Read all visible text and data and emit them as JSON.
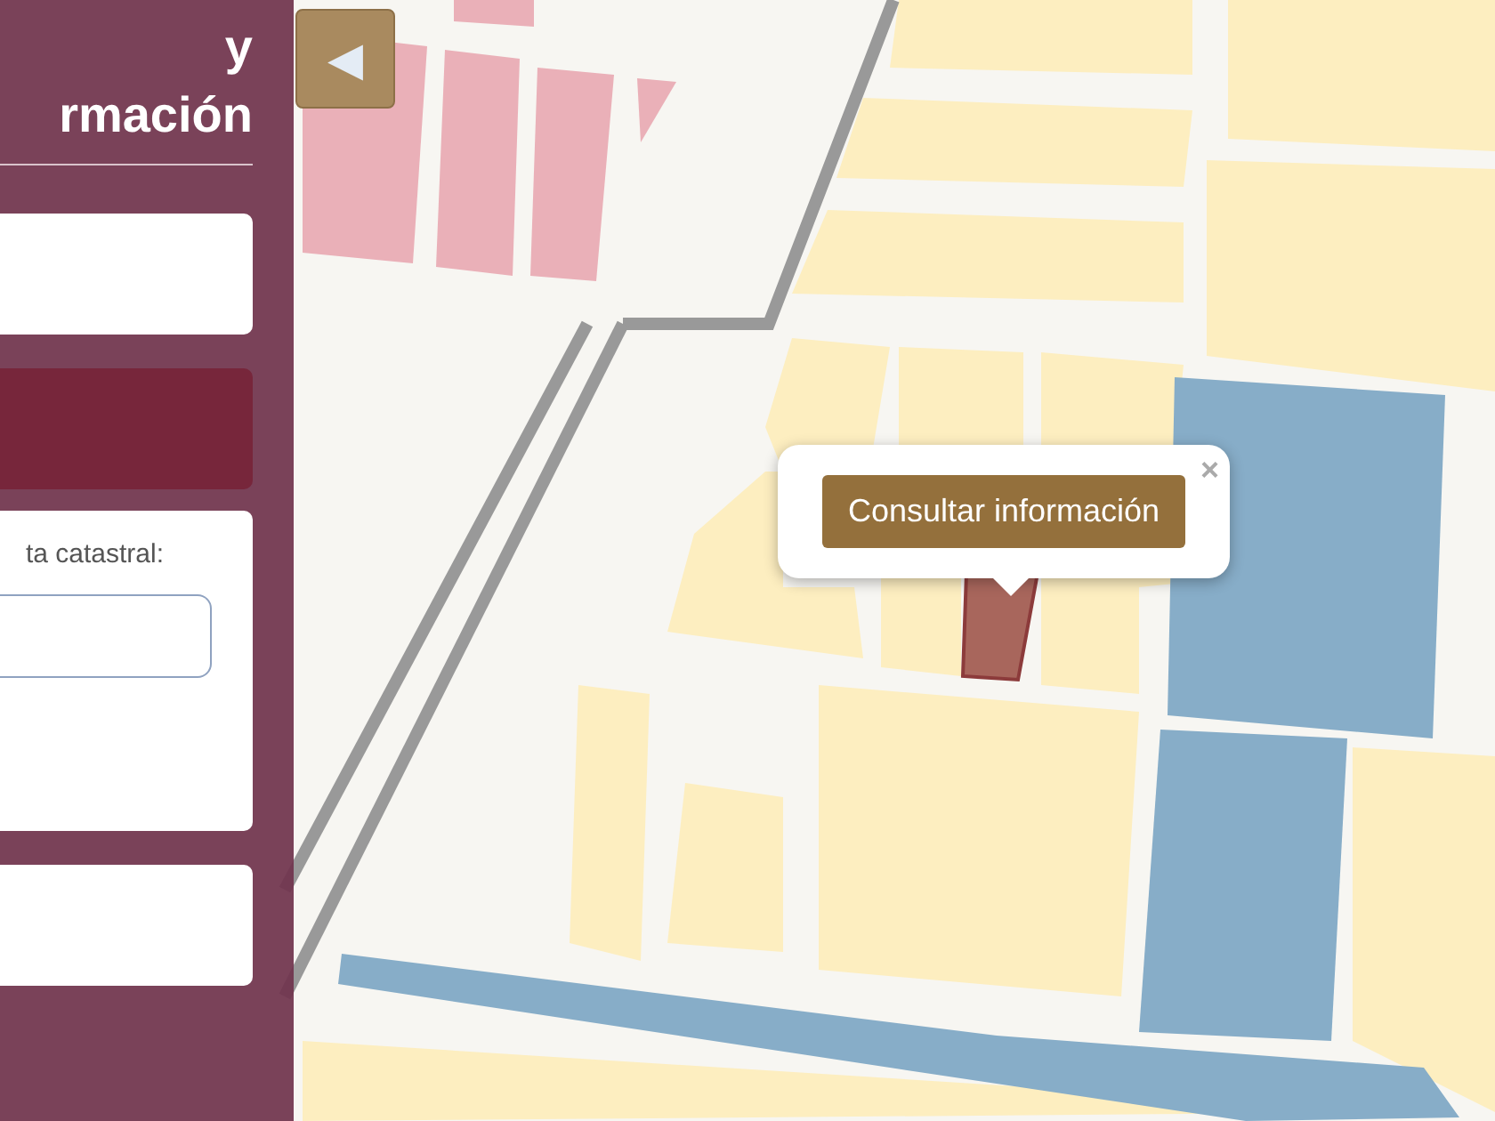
{
  "side_panel": {
    "title_lines": [
      "y",
      "rmación"
    ],
    "cards": [
      {
        "kind": "blank"
      },
      {
        "kind": "accent"
      },
      {
        "kind": "form",
        "label": "ta catastral:"
      },
      {
        "kind": "blank"
      }
    ]
  },
  "collapse_button": {
    "symbol": "◀"
  },
  "popup": {
    "button": "Consultar información",
    "close": "×"
  }
}
